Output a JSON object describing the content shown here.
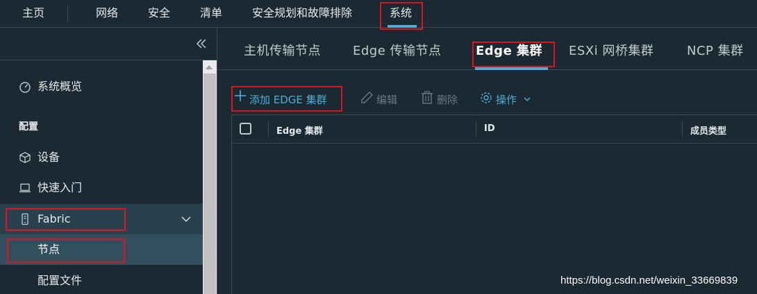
{
  "topnav": {
    "items": [
      "主页",
      "网络",
      "安全",
      "清单",
      "安全规划和故障排除",
      "系统"
    ],
    "active": "系统"
  },
  "sidebar": {
    "collapse_icon": "double-chevron-left-icon",
    "overview": "系统概览",
    "section_header": "配置",
    "items": [
      {
        "label": "设备",
        "icon": "cube-icon"
      },
      {
        "label": "快速入门",
        "icon": "laptop-icon"
      },
      {
        "label": "Fabric",
        "icon": "phone-device-icon"
      },
      {
        "label": "节点",
        "icon": ""
      },
      {
        "label": "配置文件",
        "icon": ""
      }
    ]
  },
  "tabs": [
    "主机传输节点",
    "Edge 传输节点",
    "Edge 集群",
    "ESXi 网桥集群",
    "NCP 集群"
  ],
  "active_tab": "Edge 集群",
  "toolbar": {
    "add": "添加 EDGE 集群",
    "edit": "编辑",
    "delete": "删除",
    "actions": "操作"
  },
  "grid": {
    "columns": [
      "Edge 集群",
      "ID",
      "成员类型"
    ]
  },
  "watermark": "https://blog.csdn.net/weixin_33669839",
  "colors": {
    "background": "#1b2a32",
    "accent": "#49afd9",
    "highlight_box": "#e0141e"
  }
}
